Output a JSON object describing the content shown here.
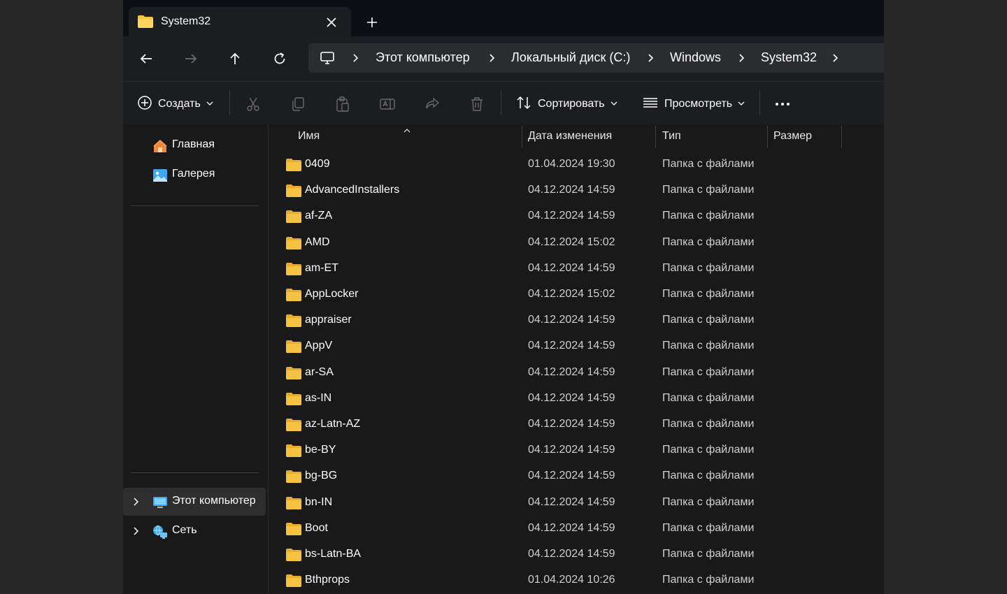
{
  "window": {
    "tab_title": "System32",
    "tab_icon": "folder-icon"
  },
  "breadcrumbs": [
    "Этот компьютер",
    "Локальный диск (C:)",
    "Windows",
    "System32"
  ],
  "commands": {
    "create": "Создать",
    "sort": "Сортировать",
    "view": "Просмотреть"
  },
  "sidebar": {
    "top_items": [
      {
        "label": "Главная",
        "icon": "home-icon"
      },
      {
        "label": "Галерея",
        "icon": "gallery-icon"
      }
    ],
    "bottom_items": [
      {
        "label": "Этот компьютер",
        "icon": "computer-icon",
        "selected": true
      },
      {
        "label": "Сеть",
        "icon": "network-icon",
        "selected": false
      }
    ]
  },
  "columns": {
    "name": "Имя",
    "date": "Дата изменения",
    "type": "Тип",
    "size": "Размер"
  },
  "files": [
    {
      "name": "0409",
      "date": "01.04.2024 19:30",
      "type": "Папка с файлами",
      "size": ""
    },
    {
      "name": "AdvancedInstallers",
      "date": "04.12.2024 14:59",
      "type": "Папка с файлами",
      "size": ""
    },
    {
      "name": "af-ZA",
      "date": "04.12.2024 14:59",
      "type": "Папка с файлами",
      "size": ""
    },
    {
      "name": "AMD",
      "date": "04.12.2024 15:02",
      "type": "Папка с файлами",
      "size": ""
    },
    {
      "name": "am-ET",
      "date": "04.12.2024 14:59",
      "type": "Папка с файлами",
      "size": ""
    },
    {
      "name": "AppLocker",
      "date": "04.12.2024 15:02",
      "type": "Папка с файлами",
      "size": ""
    },
    {
      "name": "appraiser",
      "date": "04.12.2024 14:59",
      "type": "Папка с файлами",
      "size": ""
    },
    {
      "name": "AppV",
      "date": "04.12.2024 14:59",
      "type": "Папка с файлами",
      "size": ""
    },
    {
      "name": "ar-SA",
      "date": "04.12.2024 14:59",
      "type": "Папка с файлами",
      "size": ""
    },
    {
      "name": "as-IN",
      "date": "04.12.2024 14:59",
      "type": "Папка с файлами",
      "size": ""
    },
    {
      "name": "az-Latn-AZ",
      "date": "04.12.2024 14:59",
      "type": "Папка с файлами",
      "size": ""
    },
    {
      "name": "be-BY",
      "date": "04.12.2024 14:59",
      "type": "Папка с файлами",
      "size": ""
    },
    {
      "name": "bg-BG",
      "date": "04.12.2024 14:59",
      "type": "Папка с файлами",
      "size": ""
    },
    {
      "name": "bn-IN",
      "date": "04.12.2024 14:59",
      "type": "Папка с файлами",
      "size": ""
    },
    {
      "name": "Boot",
      "date": "04.12.2024 14:59",
      "type": "Папка с файлами",
      "size": ""
    },
    {
      "name": "bs-Latn-BA",
      "date": "04.12.2024 14:59",
      "type": "Папка с файлами",
      "size": ""
    },
    {
      "name": "Bthprops",
      "date": "01.04.2024 10:26",
      "type": "Папка с файлами",
      "size": ""
    }
  ],
  "colors": {
    "folder": "#f5c242",
    "background": "#191919",
    "accent_icon": "#3fa7f0"
  }
}
